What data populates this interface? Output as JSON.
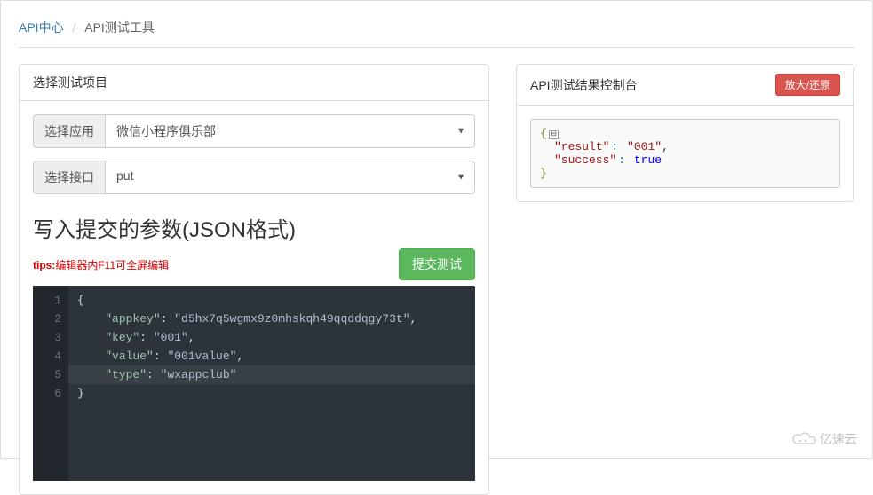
{
  "breadcrumb": {
    "root": "API中心",
    "sep": "/",
    "current": "API测试工具"
  },
  "left_panel": {
    "title": "选择测试项目",
    "app_label": "选择应用",
    "app_value": "微信小程序俱乐部",
    "iface_label": "选择接口",
    "iface_value": "put",
    "section_title": "写入提交的参数(JSON格式)",
    "tips_label": "tips:",
    "tips_text": "编辑器内F11可全屏编辑",
    "submit_label": "提交测试",
    "editor_lines": [
      "1",
      "2",
      "3",
      "4",
      "5",
      "6"
    ],
    "code": {
      "l1": "{",
      "l2_k": "\"appkey\"",
      "l2_v": "\"d5hx7q5wgmx9z0mhskqh49qqddqgy73t\"",
      "l3_k": "\"key\"",
      "l3_v": "\"001\"",
      "l4_k": "\"value\"",
      "l4_v": "\"001value\"",
      "l5_k": "\"type\"",
      "l5_v": "\"wxappclub\"",
      "l6": "}"
    }
  },
  "right_panel": {
    "title": "API测试结果控制台",
    "toggle_label": "放大/还原",
    "result": {
      "open": "{",
      "close": "}",
      "k1": "\"result\"",
      "v1": "\"001\"",
      "k2": "\"success\"",
      "v2": "true",
      "node_symbol": "⊟"
    }
  },
  "watermark": {
    "text": "亿速云"
  }
}
